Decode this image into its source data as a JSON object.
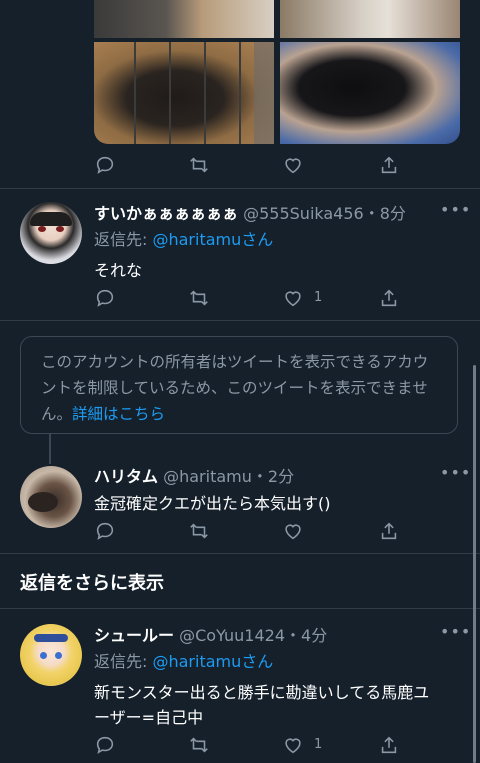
{
  "tweets": [
    {
      "name": "すいかぁぁぁぁぁぁ",
      "handle": "@555Suika456",
      "time": "8分",
      "reply_prefix": "返信先: ",
      "reply_to": "@haritamu",
      "reply_suffix": "さん",
      "text": "それな",
      "like_count": "1"
    },
    {
      "name": "ハリタム",
      "handle": "@haritamu",
      "time": "2分",
      "text": "金冠確定クエが出たら本気出す()"
    },
    {
      "name": "シュールー",
      "handle": "@CoYuu1424",
      "time": "4分",
      "reply_prefix": "返信先: ",
      "reply_to": "@haritamu",
      "reply_suffix": "さん",
      "text_line1": "新モンスター出ると勝手に勘違いしてる馬鹿ユ",
      "text_line2": "ーザー=自己中",
      "like_count": "1"
    }
  ],
  "notice": {
    "text": "このアカウントの所有者はツイートを表示できるアカウントを制限しているため、このツイートを表示できません。",
    "link": "詳細はこちら"
  },
  "show_more_replies": "返信をさらに表示",
  "more_glyph": "•••",
  "separator_dot": "・",
  "colors": {
    "background": "#15202b",
    "secondary_text": "#8b98a5",
    "link": "#1d9bf0",
    "separator": "#2f3b47"
  }
}
